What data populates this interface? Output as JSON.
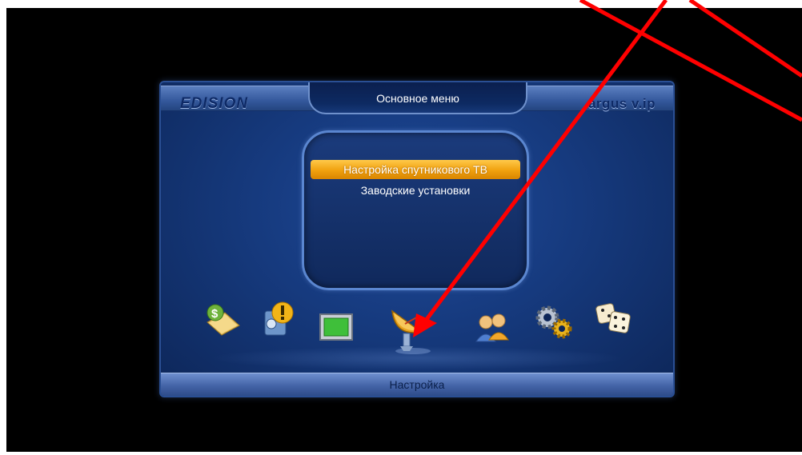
{
  "header": {
    "title": "Основное меню",
    "brand_left": "EDISION",
    "brand_right": "argus v.ip"
  },
  "submenu": {
    "items": [
      {
        "label": "Настройка спутникового ТВ",
        "selected": true
      },
      {
        "label": "Заводские установки",
        "selected": false
      }
    ]
  },
  "icons": [
    {
      "name": "money-card-icon"
    },
    {
      "name": "media-warning-icon"
    },
    {
      "name": "tv-screen-icon"
    },
    {
      "name": "satellite-dish-icon",
      "selected": true
    },
    {
      "name": "users-icon"
    },
    {
      "name": "gears-icon"
    },
    {
      "name": "dice-icon"
    }
  ],
  "footer": {
    "label": "Настройка"
  },
  "colors": {
    "highlight": "#f0a10e",
    "panel": "#163a7e",
    "annotation_arrow": "#ff0000"
  }
}
